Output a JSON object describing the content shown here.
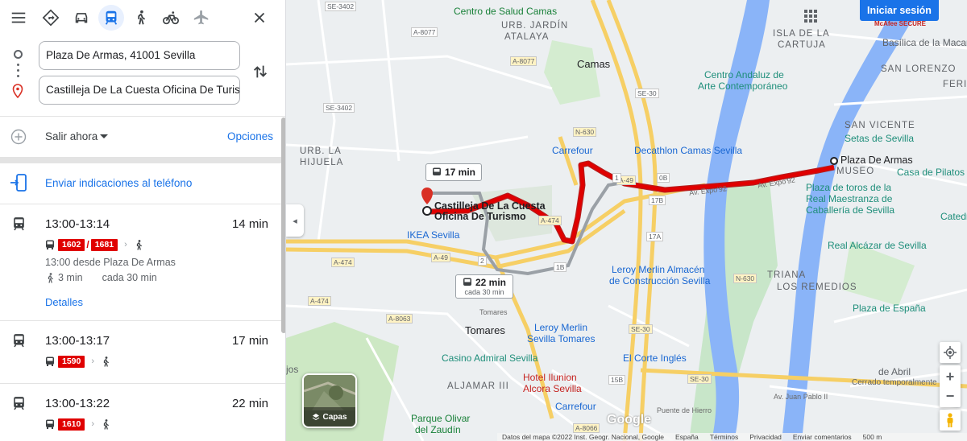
{
  "modes": {
    "menu": "menu-icon",
    "items": [
      "directions",
      "car",
      "transit",
      "walk",
      "bicycle",
      "flight"
    ],
    "active": "transit",
    "close": "close-icon"
  },
  "inputs": {
    "origin": "Plaza De Armas, 41001 Sevilla",
    "destination": "Castilleja De La Cuesta Oficina De Turismo"
  },
  "depart": {
    "label": "Salir ahora",
    "options": "Opciones"
  },
  "send": {
    "label": "Enviar indicaciones al teléfono"
  },
  "routes": [
    {
      "time_range": "13:00-13:14",
      "duration": "14 min",
      "buses": [
        "1602",
        "1681"
      ],
      "detail_depart": "13:00 desde Plaza De Armas",
      "walk": "3 min",
      "frequency": "cada 30 min",
      "details_link": "Detalles"
    },
    {
      "time_range": "13:00-13:17",
      "duration": "17 min",
      "buses": [
        "1590"
      ]
    },
    {
      "time_range": "13:00-13:22",
      "duration": "22 min",
      "buses": [
        "1610"
      ]
    }
  ],
  "map": {
    "signin": "Iniciar sesión",
    "mcafee": "McAfee SECURE",
    "callouts": {
      "a": "17 min",
      "b": "22 min",
      "b_sub": "cada 30 min"
    },
    "markers": {
      "origin": "Plaza De Armas",
      "destination": "Castilleja De La Cuesta Oficina De Turismo"
    },
    "places": {
      "centro_salud": "Centro de Salud Camas",
      "urb_jardin_1": "URB. JARDÍN",
      "urb_jardin_2": "ATALAYA",
      "camas": "Camas",
      "isla_cartuja_1": "ISLA DE LA",
      "isla_cartuja_2": "CARTUJA",
      "caac_1": "Centro Andaluz de",
      "caac_2": "Arte Contemporáneo",
      "macarena_1": "Basílica de la Macarena",
      "san_lorenzo": "SAN LORENZO",
      "feria": "FERIA",
      "hijuela_1": "URB. LA",
      "hijuela_2": "HIJUELA",
      "carrefour": "Carrefour",
      "decathlon": "Decathlon Camas Sevilla",
      "setas_1": "SAN VICENTE",
      "setas_2": "Setas de Sevilla",
      "museo": "MUSEO",
      "pilatos": "Casa de Pilatos",
      "plaza_toros_1": "Plaza de toros de la",
      "plaza_toros_2": "Real Maestranza de",
      "plaza_toros_3": "Caballería de Sevilla",
      "ikea": "IKEA Sevilla",
      "catedral": "Catedra",
      "leroy_1": "Leroy Merlin Almacén",
      "leroy_2": "de Construcción Sevilla",
      "alcazar": "Real Alcázar de Sevilla",
      "triana": "TRIANA",
      "remedios": "LOS REMEDIOS",
      "plaza_espana": "Plaza de España",
      "tomares": "Tomares",
      "leroy_t_1": "Leroy Merlin",
      "leroy_t_2": "Sevilla Tomares",
      "casino": "Casino Admiral Sevilla",
      "corte_ingles": "El Corte Inglés",
      "aljamar": "ALJAMAR III",
      "ilunion_1": "Hotel Ilunion",
      "ilunion_2": "Alcora Sevilla",
      "carrefour_2": "Carrefour",
      "parque_1": "Parque Olivar",
      "parque_2": "del Zaudín",
      "cerrado": "Cerrado temporalmente",
      "abril": "de Abril",
      "juan_pablo": "Av. Juan Pablo II",
      "puente_hierro": "Puente de Hierro",
      "av_expo_1": "Av. Expo'92",
      "av_expo_2": "Av. Expo'92",
      "tomares_ar": "Tomares",
      "jos": "jos"
    },
    "roads": [
      "A-8077",
      "A-8077",
      "SE-3402",
      "SE-3402",
      "SE-30",
      "N-630",
      "A-49",
      "A-49",
      "A-474",
      "A-474",
      "A-474",
      "A-8063",
      "SE-30",
      "SE-30",
      "N-630",
      "A-8066",
      "17B",
      "17A",
      "0B",
      "1B",
      "15B",
      "2",
      "1"
    ],
    "layers": "Capas",
    "logo": "Google",
    "attribution": [
      "Datos del mapa ©2022 Inst. Geogr. Nacional, Google",
      "España",
      "Términos",
      "Privacidad",
      "Enviar comentarios",
      "500 m"
    ]
  },
  "colors": {
    "accent": "#1a73e8",
    "route_red": "#e00000",
    "alt_route": "#9aa0a6",
    "river": "#8ab4f8",
    "highway": "#f9d36a",
    "park": "#c8e6c9"
  }
}
